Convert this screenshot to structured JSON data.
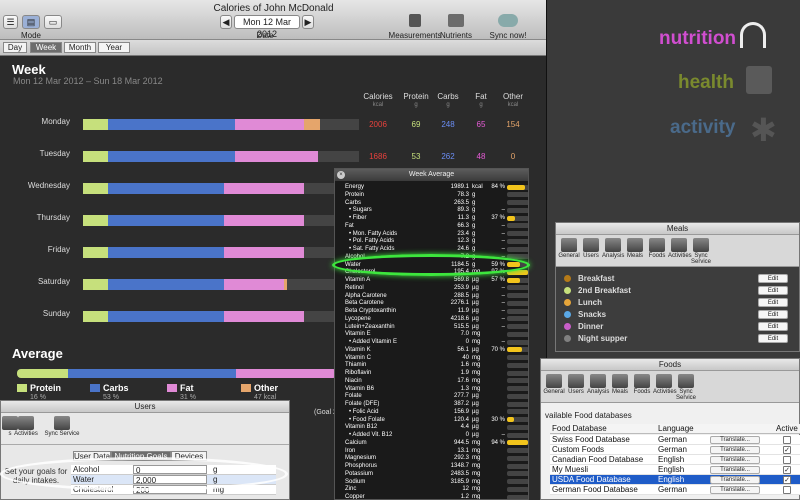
{
  "window": {
    "title": "Calories of John McDonald",
    "mode_label": "Mode",
    "date_label": "Date",
    "date_value": "Mon 12 Mar 2012",
    "prev_arrow": "◀",
    "next_arrow": "▶",
    "toolbar": {
      "measurements": "Measurements",
      "nutrients": "Nutrients",
      "sync": "Sync now!"
    },
    "tabs": [
      "Day",
      "Week",
      "Month",
      "Year"
    ],
    "selected_tab": "Week"
  },
  "week": {
    "title": "Week",
    "range": "Mon 12 Mar 2012 – Sun 18 Mar 2012",
    "columns": [
      {
        "label": "Calories",
        "unit": "kcal"
      },
      {
        "label": "Protein",
        "unit": "g"
      },
      {
        "label": "Carbs",
        "unit": "g"
      },
      {
        "label": "Fat",
        "unit": "g"
      },
      {
        "label": "Other",
        "unit": "kcal"
      }
    ],
    "colors": {
      "protein": "#c6e07c",
      "carbs": "#4a74c9",
      "fat": "#e08ad6",
      "other": "#e5a56b",
      "calories": "#e8413c",
      "protein_num": "#c6e07c",
      "carbs_num": "#6b8ef5",
      "fat_num": "#e65bd6",
      "other_num": "#e5a56b"
    },
    "days": [
      {
        "name": "Monday",
        "calories": "2006",
        "protein": "69",
        "carbs": "248",
        "fat": "65",
        "other": "154",
        "fr": [
          0.09,
          0.46,
          0.25,
          0.06
        ]
      },
      {
        "name": "Tuesday",
        "calories": "1686",
        "protein": "53",
        "carbs": "262",
        "fat": "48",
        "other": "0",
        "fr": [
          0.09,
          0.46,
          0.3,
          0
        ]
      },
      {
        "name": "Wednesday",
        "calories": "",
        "protein": "",
        "carbs": "",
        "fat": "",
        "other": "",
        "fr": [
          0.09,
          0.42,
          0.29,
          0
        ]
      },
      {
        "name": "Thursday",
        "calories": "",
        "protein": "",
        "carbs": "",
        "fat": "",
        "other": "",
        "fr": [
          0.09,
          0.42,
          0.29,
          0
        ]
      },
      {
        "name": "Friday",
        "calories": "",
        "protein": "",
        "carbs": "",
        "fat": "",
        "other": "",
        "fr": [
          0.09,
          0.42,
          0.29,
          0
        ]
      },
      {
        "name": "Saturday",
        "calories": "",
        "protein": "",
        "carbs": "",
        "fat": "",
        "other": "",
        "fr": [
          0.09,
          0.42,
          0.22,
          0.01
        ]
      },
      {
        "name": "Sunday",
        "calories": "",
        "protein": "",
        "carbs": "",
        "fat": "",
        "other": "",
        "fr": [
          0.09,
          0.42,
          0.29,
          0
        ]
      }
    ]
  },
  "average": {
    "title": "Average",
    "fr": [
      0.16,
      0.53,
      0.31,
      0.01
    ],
    "legend": [
      {
        "label": "Protein",
        "pct": "16 %"
      },
      {
        "label": "Carbs",
        "pct": "53 %"
      },
      {
        "label": "Fat",
        "pct": "31 %"
      },
      {
        "label": "Other",
        "pct": "47 kcal"
      }
    ],
    "goal_fragment": "(Goal 2"
  },
  "week_average": {
    "title": "Week Average",
    "rows": [
      {
        "name": "Energy",
        "value": "1989.1",
        "unit": "kcal",
        "pct": "84 %",
        "fill": 0.84,
        "color": "#f2c41c",
        "indent": 0
      },
      {
        "name": "Protein",
        "value": "78.3",
        "unit": "g",
        "pct": "",
        "fill": 0,
        "color": "#f2c41c",
        "indent": 0
      },
      {
        "name": "Carbs",
        "value": "263.5",
        "unit": "g",
        "pct": "",
        "fill": 0,
        "color": "#f2c41c",
        "indent": 0
      },
      {
        "name": "• Sugars",
        "value": "89.3",
        "unit": "g",
        "pct": "–",
        "fill": 0,
        "color": "#f2c41c",
        "indent": 1
      },
      {
        "name": "• Fiber",
        "value": "11.3",
        "unit": "g",
        "pct": "37 %",
        "fill": 0.37,
        "color": "#f2c41c",
        "indent": 1
      },
      {
        "name": "Fat",
        "value": "66.3",
        "unit": "g",
        "pct": "–",
        "fill": 0,
        "color": "#f2c41c",
        "indent": 0
      },
      {
        "name": "• Mon. Fatty Acids",
        "value": "23.4",
        "unit": "g",
        "pct": "–",
        "fill": 0,
        "color": "#f2c41c",
        "indent": 1
      },
      {
        "name": "• Pol. Fatty Acids",
        "value": "12.3",
        "unit": "g",
        "pct": "–",
        "fill": 0,
        "color": "#f2c41c",
        "indent": 1
      },
      {
        "name": "• Sat. Fatty Acids",
        "value": "24.6",
        "unit": "g",
        "pct": "–",
        "fill": 0,
        "color": "#f2c41c",
        "indent": 1
      },
      {
        "name": "Alcohol",
        "value": "7.2",
        "unit": "g",
        "pct": "–",
        "fill": 0,
        "color": "#f2c41c",
        "indent": 0
      },
      {
        "name": "Water",
        "value": "1184.5",
        "unit": "g",
        "pct": "59 %",
        "fill": 0.59,
        "color": "#f2c41c",
        "indent": 0
      },
      {
        "name": "Cholesterol",
        "value": "195.4",
        "unit": "mg",
        "pct": "97 %",
        "fill": 0.97,
        "color": "#f2c41c",
        "indent": 0
      },
      {
        "name": "Vitamin A",
        "value": "569.8",
        "unit": "µg",
        "pct": "57 %",
        "fill": 0.57,
        "color": "#f2c41c",
        "indent": 0
      },
      {
        "name": "Retinol",
        "value": "253.9",
        "unit": "µg",
        "pct": "–",
        "fill": 0,
        "color": "#f2c41c",
        "indent": 0
      },
      {
        "name": "Alpha Carotene",
        "value": "288.5",
        "unit": "µg",
        "pct": "–",
        "fill": 0,
        "color": "#f2c41c",
        "indent": 0
      },
      {
        "name": "Beta Carotene",
        "value": "2276.1",
        "unit": "µg",
        "pct": "–",
        "fill": 0,
        "color": "#f2c41c",
        "indent": 0
      },
      {
        "name": "Beta Cryptoxanthin",
        "value": "11.9",
        "unit": "µg",
        "pct": "–",
        "fill": 0,
        "color": "#f2c41c",
        "indent": 0
      },
      {
        "name": "Lycopene",
        "value": "4218.6",
        "unit": "µg",
        "pct": "–",
        "fill": 0,
        "color": "#f2c41c",
        "indent": 0
      },
      {
        "name": "Lutein+Zeaxanthin",
        "value": "515.5",
        "unit": "µg",
        "pct": "–",
        "fill": 0,
        "color": "#f2c41c",
        "indent": 0
      },
      {
        "name": "Vitamin E",
        "value": "7.0",
        "unit": "mg",
        "pct": "",
        "fill": 0,
        "color": "#f2c41c",
        "indent": 0
      },
      {
        "name": "• Added Vitamin E",
        "value": "0",
        "unit": "mg",
        "pct": "–",
        "fill": 0,
        "color": "#f2c41c",
        "indent": 1
      },
      {
        "name": "Vitamin K",
        "value": "56.1",
        "unit": "µg",
        "pct": "70 %",
        "fill": 0.7,
        "color": "#f2c41c",
        "indent": 0
      },
      {
        "name": "Vitamin C",
        "value": "40",
        "unit": "mg",
        "pct": "",
        "fill": 0,
        "color": "#f2c41c",
        "indent": 0
      },
      {
        "name": "Thiamin",
        "value": "1.6",
        "unit": "mg",
        "pct": "",
        "fill": 0,
        "color": "#f2c41c",
        "indent": 0
      },
      {
        "name": "Riboflavin",
        "value": "1.9",
        "unit": "mg",
        "pct": "",
        "fill": 0,
        "color": "#f2c41c",
        "indent": 0
      },
      {
        "name": "Niacin",
        "value": "17.6",
        "unit": "mg",
        "pct": "",
        "fill": 0,
        "color": "#f2c41c",
        "indent": 0
      },
      {
        "name": "Vitamin B6",
        "value": "1.3",
        "unit": "mg",
        "pct": "",
        "fill": 0,
        "color": "#f2c41c",
        "indent": 0
      },
      {
        "name": "Folate",
        "value": "277.7",
        "unit": "µg",
        "pct": "",
        "fill": 0,
        "color": "#f2c41c",
        "indent": 0
      },
      {
        "name": "Folate (DFE)",
        "value": "387.2",
        "unit": "µg",
        "pct": "",
        "fill": 0,
        "color": "#f2c41c",
        "indent": 0
      },
      {
        "name": "• Folic Acid",
        "value": "156.9",
        "unit": "µg",
        "pct": "",
        "fill": 0,
        "color": "#f2c41c",
        "indent": 1
      },
      {
        "name": "• Food Folate",
        "value": "120.4",
        "unit": "µg",
        "pct": "30 %",
        "fill": 0.3,
        "color": "#f2c41c",
        "indent": 1
      },
      {
        "name": "Vitamin B12",
        "value": "4.4",
        "unit": "µg",
        "pct": "",
        "fill": 0,
        "color": "#f2c41c",
        "indent": 0
      },
      {
        "name": "• Added Vit. B12",
        "value": "0",
        "unit": "µg",
        "pct": "–",
        "fill": 0,
        "color": "#f2c41c",
        "indent": 1
      },
      {
        "name": "Calcium",
        "value": "944.5",
        "unit": "mg",
        "pct": "94 %",
        "fill": 0.94,
        "color": "#f2c41c",
        "indent": 0
      },
      {
        "name": "Iron",
        "value": "13.1",
        "unit": "mg",
        "pct": "",
        "fill": 0,
        "color": "#f2c41c",
        "indent": 0
      },
      {
        "name": "Magnesium",
        "value": "292.3",
        "unit": "mg",
        "pct": "",
        "fill": 0,
        "color": "#f2c41c",
        "indent": 0
      },
      {
        "name": "Phosphorus",
        "value": "1348.7",
        "unit": "mg",
        "pct": "",
        "fill": 0,
        "color": "#f2c41c",
        "indent": 0
      },
      {
        "name": "Potassium",
        "value": "2483.5",
        "unit": "mg",
        "pct": "",
        "fill": 0,
        "color": "#f2c41c",
        "indent": 0
      },
      {
        "name": "Sodium",
        "value": "3185.9",
        "unit": "mg",
        "pct": "",
        "fill": 0,
        "color": "#f2c41c",
        "indent": 0
      },
      {
        "name": "Zinc",
        "value": "12",
        "unit": "mg",
        "pct": "",
        "fill": 0,
        "color": "#f2c41c",
        "indent": 0
      },
      {
        "name": "Copper",
        "value": "1.2",
        "unit": "mg",
        "pct": "",
        "fill": 0,
        "color": "#f2c41c",
        "indent": 0
      }
    ]
  },
  "brand": {
    "nutrition": "nutrition",
    "health": "health",
    "activity": "activity"
  },
  "meals_window": {
    "title": "Meals",
    "tools": [
      "General",
      "Users",
      "Analysis",
      "Meals",
      "Foods",
      "Activities",
      "Sync Service"
    ],
    "meals": [
      {
        "name": "Breakfast",
        "color": "#b57a18",
        "edit": "Edit"
      },
      {
        "name": "2nd Breakfast",
        "color": "#c6e07c",
        "edit": "Edit"
      },
      {
        "name": "Lunch",
        "color": "#e6a53a",
        "edit": "Edit"
      },
      {
        "name": "Snacks",
        "color": "#5aa8e6",
        "edit": "Edit"
      },
      {
        "name": "Dinner",
        "color": "#c85ec8",
        "edit": "Edit"
      },
      {
        "name": "Night supper",
        "color": "#808080",
        "edit": "Edit"
      }
    ]
  },
  "foods_window": {
    "title": "Foods",
    "tools": [
      "General",
      "Users",
      "Analysis",
      "Meals",
      "Foods",
      "Activities",
      "Sync Service"
    ],
    "section": "vailable Food databases",
    "headers": [
      "Food Database",
      "Language",
      "",
      "Active"
    ],
    "rows": [
      {
        "name": "Swiss Food Database",
        "lang": "German",
        "translate": "Translate...",
        "active": "",
        "selected": false
      },
      {
        "name": "Custom Foods",
        "lang": "German",
        "translate": "Translate...",
        "active": "✓",
        "selected": false
      },
      {
        "name": "Canadian Food Database",
        "lang": "English",
        "translate": "Translate...",
        "active": "",
        "selected": false
      },
      {
        "name": "My Muesli",
        "lang": "English",
        "translate": "Translate...",
        "active": "✓",
        "selected": false
      },
      {
        "name": "USDA Food Database",
        "lang": "English",
        "translate": "Translate...",
        "active": "✓",
        "selected": true
      },
      {
        "name": "German Food Database",
        "lang": "German",
        "translate": "Translate...",
        "active": "",
        "selected": false
      }
    ]
  },
  "users_window": {
    "title": "Users",
    "tools": [
      "s",
      "Activities",
      "Sync Service"
    ],
    "tabs": [
      "User Data",
      "Nutrition Goals",
      "Devices"
    ],
    "goals_hint": "Set your goals for daily intakes.",
    "goals": [
      {
        "name": "Alcohol",
        "value": "0",
        "unit": "g"
      },
      {
        "name": "Water",
        "value": "2,000",
        "unit": "g"
      },
      {
        "name": "Cholesterol",
        "value": "200",
        "unit": "mg"
      }
    ]
  }
}
